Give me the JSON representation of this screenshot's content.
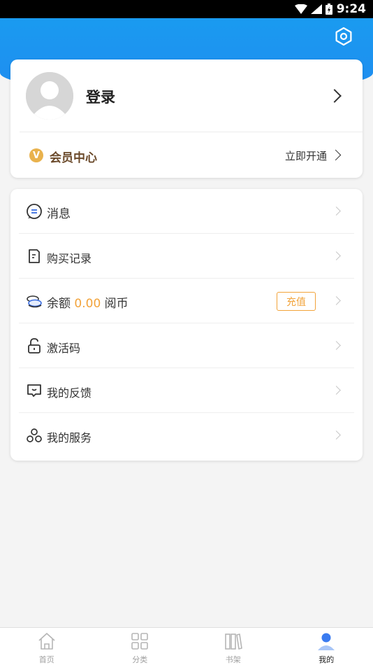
{
  "status_bar": {
    "time": "9:24"
  },
  "profile": {
    "login_label": "登录"
  },
  "vip": {
    "badge": "V",
    "label": "会员中心",
    "action": "立即开通"
  },
  "menu": {
    "messages": "消息",
    "purchases": "购买记录",
    "balance": {
      "prefix": "余额",
      "amount": "0.00",
      "unit": "阅币",
      "recharge": "充值"
    },
    "activation": "激活码",
    "feedback": "我的反馈",
    "services": "我的服务"
  },
  "tabs": [
    {
      "label": "首页",
      "icon": "home-icon"
    },
    {
      "label": "分类",
      "icon": "grid-icon"
    },
    {
      "label": "书架",
      "icon": "bookshelf-icon"
    },
    {
      "label": "我的",
      "icon": "profile-icon",
      "active": true
    }
  ],
  "colors": {
    "header_blue": "#1f8cf0",
    "accent_orange": "#f2a33a",
    "vip_gold": "#e9b24d",
    "vip_text": "#6b4a2b"
  }
}
